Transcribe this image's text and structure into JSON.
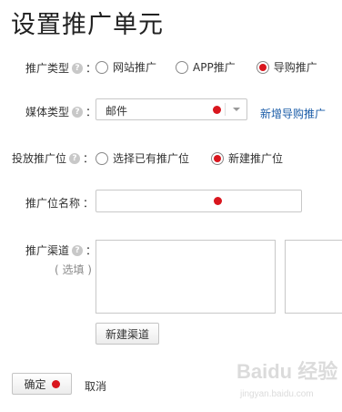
{
  "page": {
    "title": "设置推广单元"
  },
  "form": {
    "promo_type": {
      "label": "推广类型",
      "help": "?",
      "options": [
        {
          "label": "网站推广",
          "checked": false
        },
        {
          "label": "APP推广",
          "checked": false
        },
        {
          "label": "导购推广",
          "checked": true
        }
      ]
    },
    "media_type": {
      "label": "媒体类型",
      "help": "?",
      "selected": "邮件",
      "link": "新增导购推广"
    },
    "placement": {
      "label": "投放推广位",
      "help": "?",
      "options": [
        {
          "label": "选择已有推广位",
          "checked": false
        },
        {
          "label": "新建推广位",
          "checked": true
        }
      ]
    },
    "placement_name": {
      "label": "推广位名称",
      "value": ""
    },
    "channel": {
      "label": "推广渠道",
      "help": "?",
      "note": "( 选填 )",
      "new_button": "新建渠道"
    },
    "colon": "："
  },
  "actions": {
    "confirm": "确定",
    "cancel": "取消"
  },
  "watermark": {
    "text": "Baidu 经验",
    "url": "jingyan.baidu.com"
  },
  "colors": {
    "accent": "#d9161e",
    "link": "#1a5ca8"
  }
}
